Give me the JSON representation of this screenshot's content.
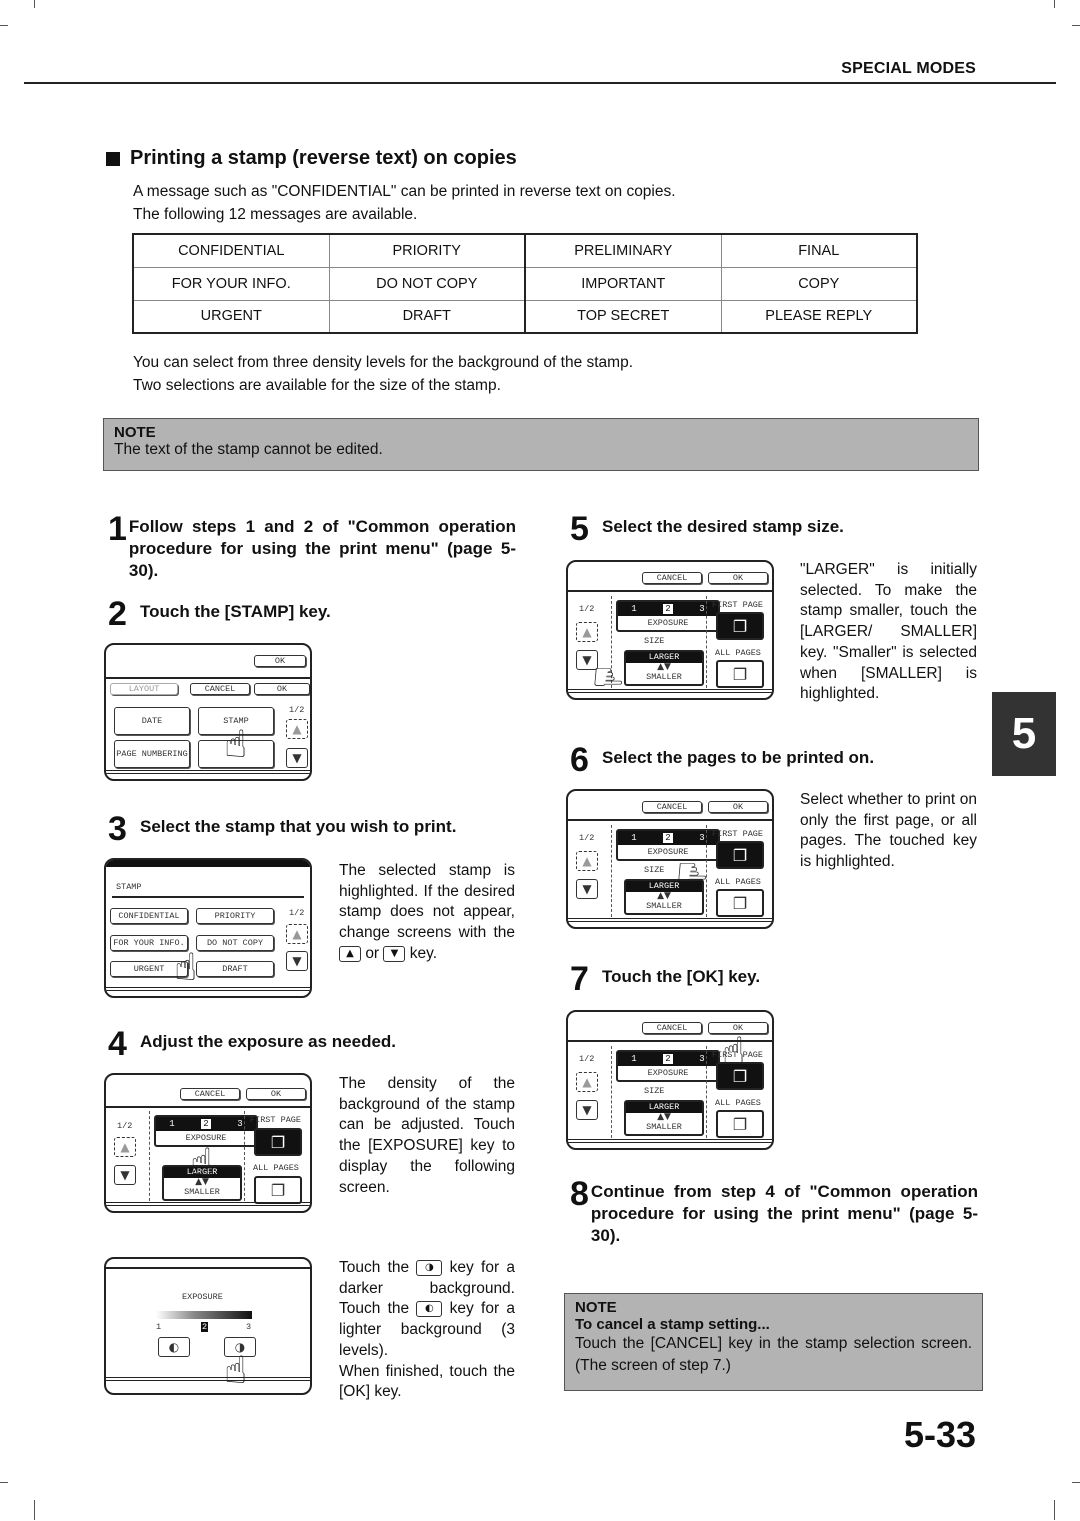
{
  "header": {
    "section": "SPECIAL MODES"
  },
  "chapter_tab": "5",
  "page_number": "5-33",
  "section_title": "Printing a stamp (reverse text) on copies",
  "intro": [
    "A message such as \"CONFIDENTIAL\" can be printed in reverse text on copies.",
    "The following 12 messages are available."
  ],
  "stamp_table": [
    [
      "CONFIDENTIAL",
      "PRIORITY",
      "PRELIMINARY",
      "FINAL"
    ],
    [
      "FOR YOUR INFO.",
      "DO NOT COPY",
      "IMPORTANT",
      "COPY"
    ],
    [
      "URGENT",
      "DRAFT",
      "TOP SECRET",
      "PLEASE REPLY"
    ]
  ],
  "density_text": [
    "You can select from three density levels for the background of the stamp.",
    "Two selections are available for the size of the stamp."
  ],
  "note1": {
    "heading": "NOTE",
    "body": "The text of the stamp cannot be edited."
  },
  "steps": [
    {
      "num": "1",
      "text": "Follow steps 1 and 2 of \"Common operation procedure for using the print menu\" (page 5-30)."
    },
    {
      "num": "2",
      "text": "Touch the [STAMP] key."
    },
    {
      "num": "3",
      "text": "Select the stamp that you wish to print."
    },
    {
      "num": "4",
      "text": "Adjust the exposure as needed."
    },
    {
      "num": "5",
      "text": "Select the desired stamp size."
    },
    {
      "num": "6",
      "text": "Select the pages to be printed on."
    },
    {
      "num": "7",
      "text": "Touch the [OK] key."
    },
    {
      "num": "8",
      "text": "Continue from step 4 of \"Common operation procedure for using the print menu\" (page 5-30)."
    }
  ],
  "desc": {
    "step3_a": "The selected stamp is highlighted. If the desired stamp does not appear, change screens with the",
    "step3_or": "or",
    "step3_key": "key.",
    "step4": "The density of the background of the stamp can be adjusted. Touch the [EXPOSURE] key to display the following screen.",
    "step4b_1": "Touch the",
    "step4b_2": "key for a darker background.",
    "step4b_3": "Touch the",
    "step4b_4": "key for a lighter background (3 levels).",
    "step4b_5": "When finished, touch the [OK] key.",
    "step5": "\"LARGER\" is initially selected. To make the stamp smaller, touch the [LARGER/ SMALLER] key. \"Smaller\" is selected when [SMALLER] is highlighted.",
    "step6": "Select whether to print on only the first page, or all pages. The touched key is highlighted."
  },
  "note2": {
    "heading": "NOTE",
    "subheading": "To cancel a stamp setting...",
    "body": "Touch the [CANCEL] key in the stamp selection screen. (The screen of step 7.)"
  },
  "screens": {
    "s2": {
      "ok_top": "OK",
      "layout": "LAYOUT",
      "cancel": "CANCEL",
      "ok": "OK",
      "date": "DATE",
      "stamp": "STAMP",
      "page_numbering": "PAGE NUMBERING",
      "page": "1/2"
    },
    "s3": {
      "title": "STAMP",
      "items": [
        "CONFIDENTIAL",
        "PRIORITY",
        "FOR YOUR INFO.",
        "DO NOT COPY",
        "URGENT",
        "DRAFT"
      ],
      "page": "1/2"
    },
    "stamp_settings": {
      "cancel": "CANCEL",
      "ok": "OK",
      "page": "1/2",
      "levels": [
        "1",
        "2",
        "3"
      ],
      "selected_level": "2",
      "exposure": "EXPOSURE",
      "size": "SIZE",
      "larger": "LARGER",
      "smaller": "SMALLER",
      "first_page": "FIRST PAGE",
      "all_pages": "ALL PAGES"
    },
    "exposure_screen": {
      "title": "EXPOSURE",
      "min": "1",
      "mid": "2",
      "max": "3",
      "level": 2
    }
  },
  "icons": {
    "up": "▲",
    "down": "▼",
    "hand": "☝",
    "light": "◐",
    "dark": "◑",
    "pages": "❐"
  }
}
